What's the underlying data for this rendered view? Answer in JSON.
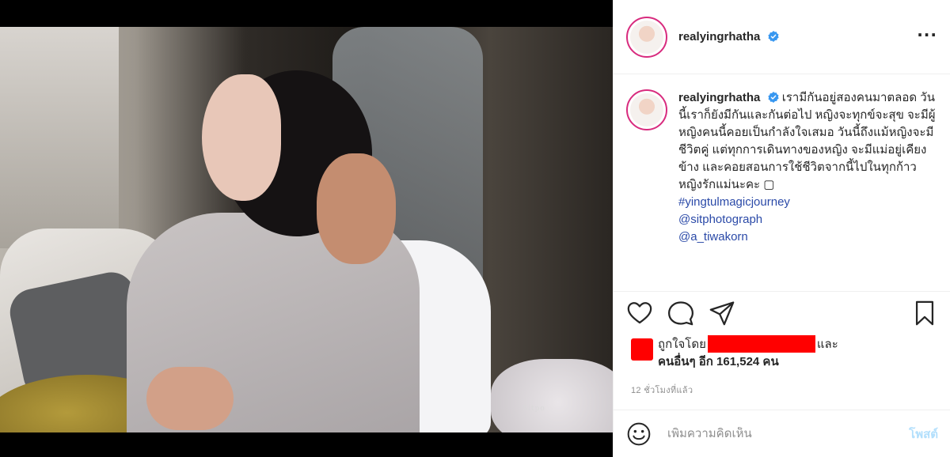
{
  "post": {
    "username": "realyingrhatha",
    "verified": true,
    "more_label": "···"
  },
  "caption": {
    "username": "realyingrhatha",
    "text": " เรามีกันอยู่สองคนมาตลอด วันนี้เราก็ยังมีกันและกันต่อไป หญิงจะทุกข์จะสุข จะมีผู้หญิงคนนี้คอยเป็นกำลังใจเสมอ วันนี้ถึงแม้หญิงจะมีชีวิตคู่ แต่ทุกการเดินทางของหญิง จะมีแม่อยู่เคียงข้าง และคอยสอนการใช้ชีวิตจากนี้ไปในทุกก้าว หญิงรักแม่นะคะ ▢",
    "hashtag": "#yingtulmagicjourney",
    "mention1": "@sitphotograph",
    "mention2": "@a_tiwakorn"
  },
  "likes": {
    "prefix": "ถูกใจโดย",
    "suffix": "และ",
    "others_label": "คนอื่นๆ อีก 161,524 คน"
  },
  "timestamp": "12 ชั่วโมงที่แล้ว",
  "comment": {
    "placeholder": "เพิ่มความคิดเห็น",
    "post_label": "โพสต์"
  },
  "icons": {
    "like": "heart-icon",
    "comment": "comment-icon",
    "share": "paper-plane-icon",
    "save": "bookmark-icon",
    "emoji": "smiley-icon",
    "verified": "verified-badge-icon",
    "more": "ellipsis-icon"
  },
  "colors": {
    "verified": "#3897f0",
    "link": "#2b4aa8",
    "post_button": "#b2dffc",
    "redaction": "#ff0000",
    "avatar_ring": "#d82b7e"
  }
}
